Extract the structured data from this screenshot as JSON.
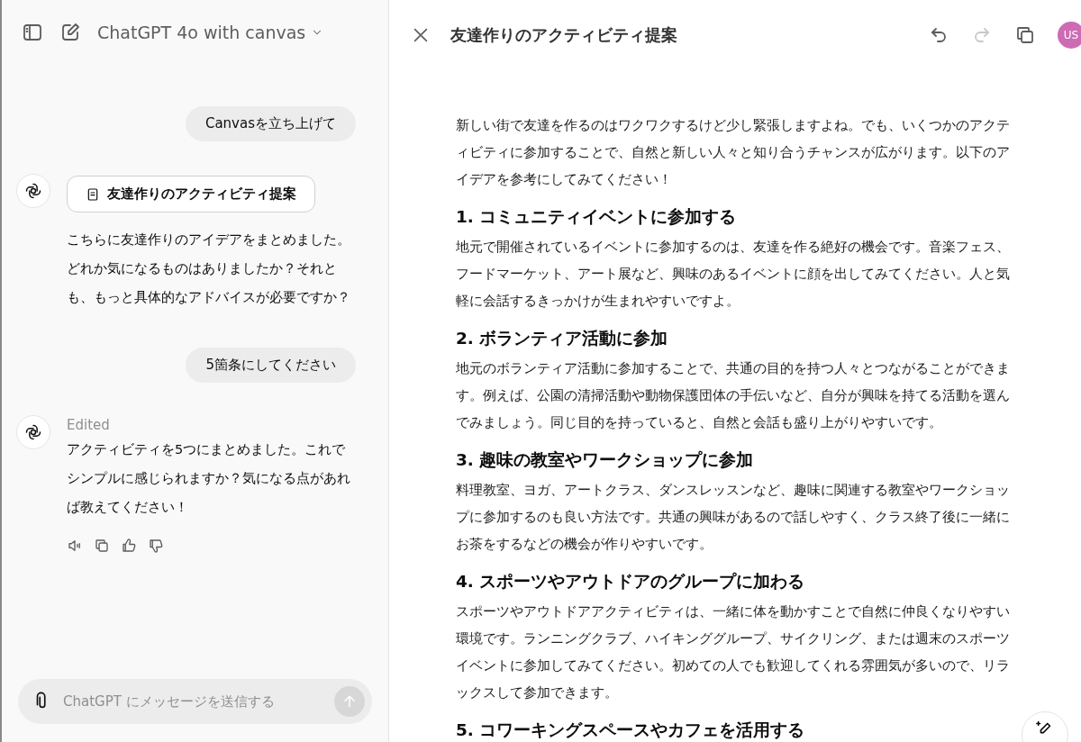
{
  "chat": {
    "model": "ChatGPT 4o with canvas",
    "messages": [
      {
        "kind": "user",
        "text": "Canvasを立ち上げて"
      },
      {
        "kind": "assistant",
        "doc": "友達作りのアクティビティ提案",
        "text": "こちらに友達作りのアイデアをまとめました。どれか気になるものはありましたか？それとも、もっと具体的なアドバイスが必要ですか？"
      },
      {
        "kind": "user",
        "text": "5箇条にしてください"
      },
      {
        "kind": "assistant",
        "status": "Edited",
        "text": "アクティビティを5つにまとめました。これでシンプルに感じられますか？気になる点があれば教えてください！",
        "actions": true
      }
    ],
    "input": {
      "placeholder": "ChatGPT にメッセージを送信する"
    }
  },
  "canvas": {
    "title": "友達作りのアクティビティ提案",
    "avatar": "US",
    "intro": "新しい街で友達を作るのはワクワクするけど少し緊張しますよね。でも、いくつかのアクティビティに参加することで、自然と新しい人々と知り合うチャンスが広がります。以下のアイデアを参考にしてみてください！",
    "sections": [
      {
        "heading": "1. コミュニティイベントに参加する",
        "body": "地元で開催されているイベントに参加するのは、友達を作る絶好の機会です。音楽フェス、フードマーケット、アート展など、興味のあるイベントに顔を出してみてください。人と気軽に会話するきっかけが生まれやすいですよ。"
      },
      {
        "heading": "2. ボランティア活動に参加",
        "body": "地元のボランティア活動に参加することで、共通の目的を持つ人々とつながることができます。例えば、公園の清掃活動や動物保護団体の手伝いなど、自分が興味を持てる活動を選んでみましょう。同じ目的を持っていると、自然と会話も盛り上がりやすいです。"
      },
      {
        "heading": "3. 趣味の教室やワークショップに参加",
        "body": "料理教室、ヨガ、アートクラス、ダンスレッスンなど、趣味に関連する教室やワークショップに参加するのも良い方法です。共通の興味があるので話しやすく、クラス終了後に一緒にお茶をするなどの機会が作りやすいです。"
      },
      {
        "heading": "4. スポーツやアウトドアのグループに加わる",
        "body": "スポーツやアウトドアアクティビティは、一緒に体を動かすことで自然に仲良くなりやすい環境です。ランニングクラブ、ハイキンググループ、サイクリング、または週末のスポーツイベントに参加してみてください。初めての人でも歓迎してくれる雰囲気が多いので、リラックスして参加できます。"
      },
      {
        "heading": "5. コワーキングスペースやカフェを活用する"
      }
    ]
  }
}
